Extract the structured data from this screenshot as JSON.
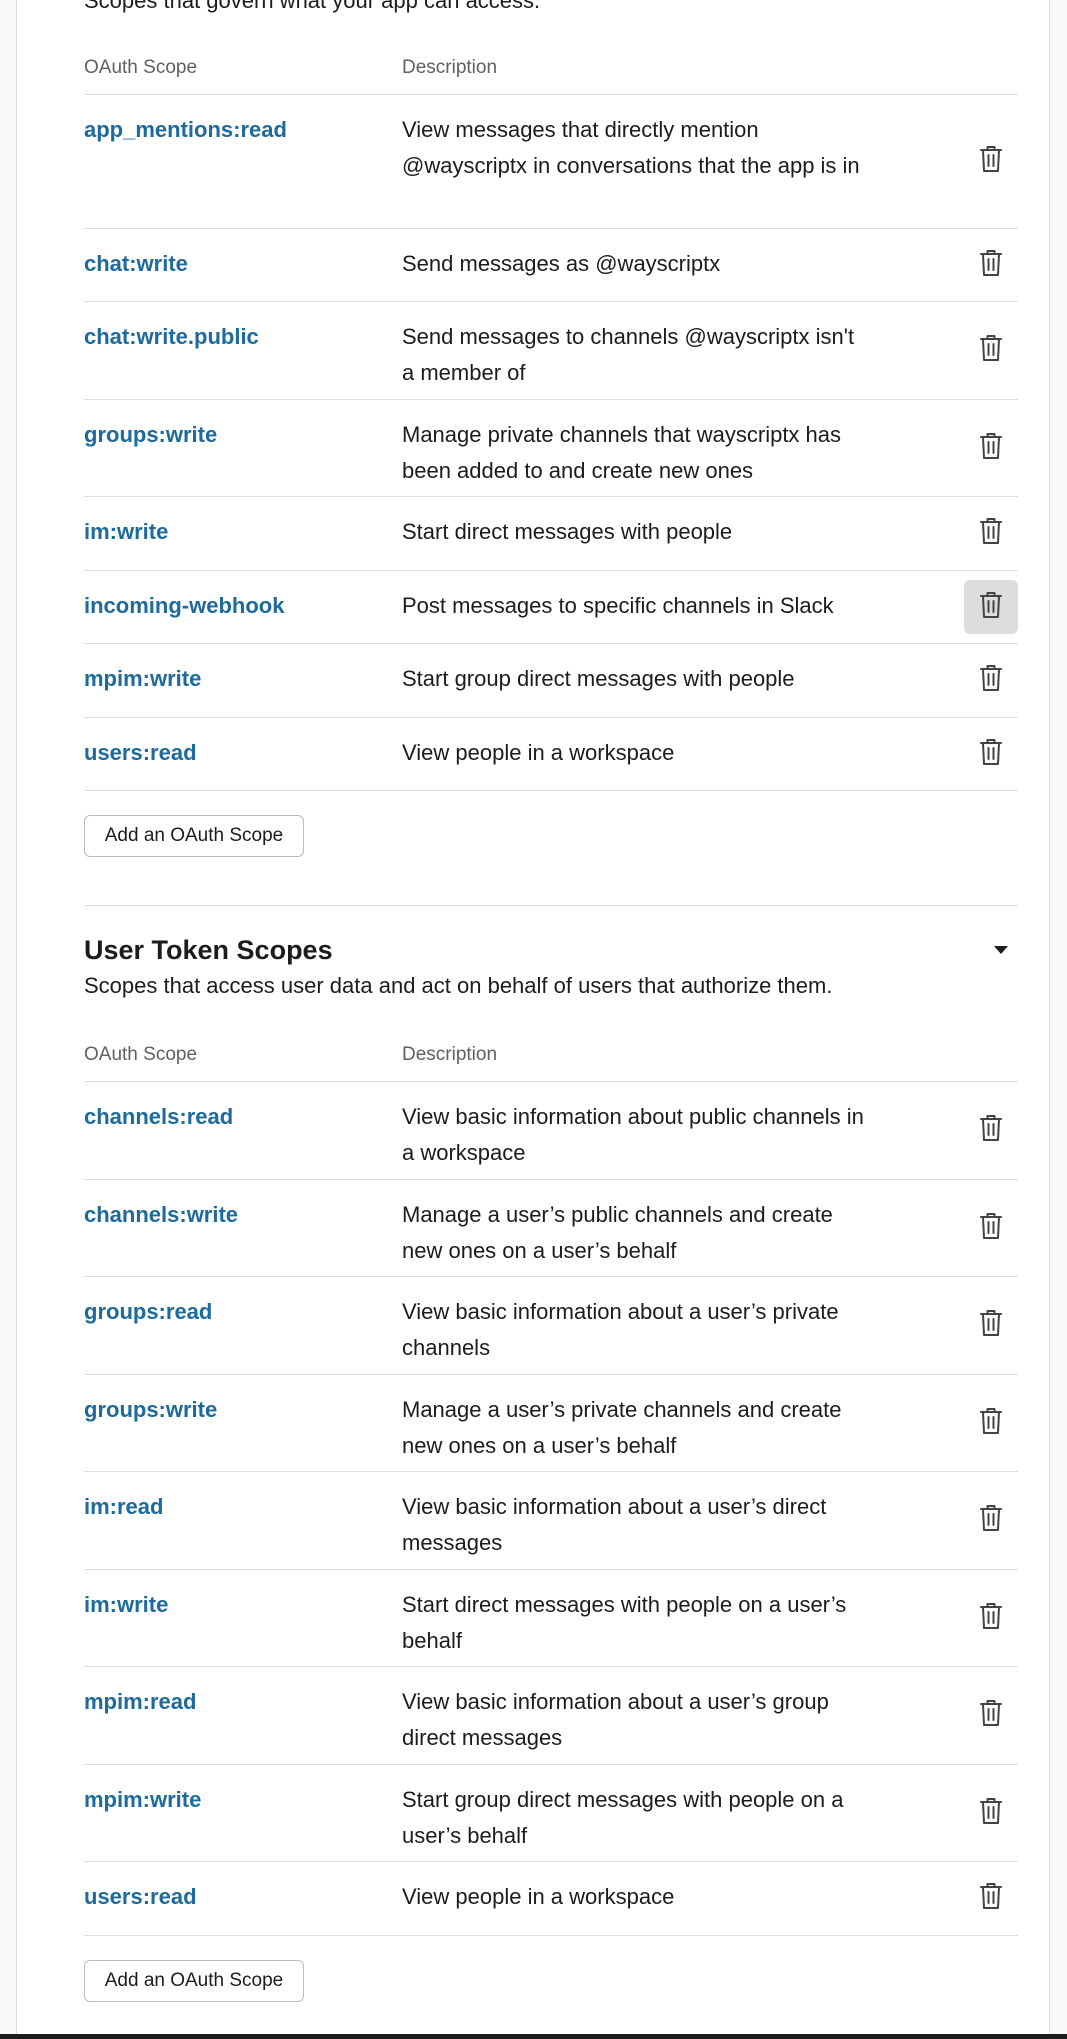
{
  "bot_scopes": {
    "intro": "Scopes that govern what your app can access.",
    "headers": {
      "scope": "OAuth Scope",
      "description": "Description"
    },
    "rows": [
      {
        "scope": "app_mentions:read",
        "description": "View messages that directly mention @wayscriptx in conversations that the app is in"
      },
      {
        "scope": "chat:write",
        "description": "Send messages as @wayscriptx"
      },
      {
        "scope": "chat:write.public",
        "description": "Send messages to channels @wayscriptx isn't a member of"
      },
      {
        "scope": "groups:write",
        "description": "Manage private channels that wayscriptx has been added to and create new ones"
      },
      {
        "scope": "im:write",
        "description": "Start direct messages with people"
      },
      {
        "scope": "incoming-webhook",
        "description": "Post messages to specific channels in Slack"
      },
      {
        "scope": "mpim:write",
        "description": "Start group direct messages with people"
      },
      {
        "scope": "users:read",
        "description": "View people in a workspace"
      }
    ],
    "add_button": "Add an OAuth Scope"
  },
  "user_scopes": {
    "title": "User Token Scopes",
    "subtitle": "Scopes that access user data and act on behalf of users that authorize them.",
    "headers": {
      "scope": "OAuth Scope",
      "description": "Description"
    },
    "rows": [
      {
        "scope": "channels:read",
        "description": "View basic information about public channels in a workspace"
      },
      {
        "scope": "channels:write",
        "description": "Manage a user’s public channels and create new ones on a user’s behalf"
      },
      {
        "scope": "groups:read",
        "description": "View basic information about a user’s private channels"
      },
      {
        "scope": "groups:write",
        "description": "Manage a user’s private channels and create new ones on a user’s behalf"
      },
      {
        "scope": "im:read",
        "description": "View basic information about a user’s direct messages"
      },
      {
        "scope": "im:write",
        "description": "Start direct messages with people on a user’s behalf"
      },
      {
        "scope": "mpim:read",
        "description": "View basic information about a user’s group direct messages"
      },
      {
        "scope": "mpim:write",
        "description": "Start group direct messages with people on a user’s behalf"
      },
      {
        "scope": "users:read",
        "description": "View people in a workspace"
      }
    ],
    "add_button": "Add an OAuth Scope"
  },
  "icons": {
    "delete": "trash-icon",
    "collapse": "caret-down-icon"
  },
  "colors": {
    "scope_link": "#1d6a9c",
    "hover_bg": "#dddddd"
  }
}
